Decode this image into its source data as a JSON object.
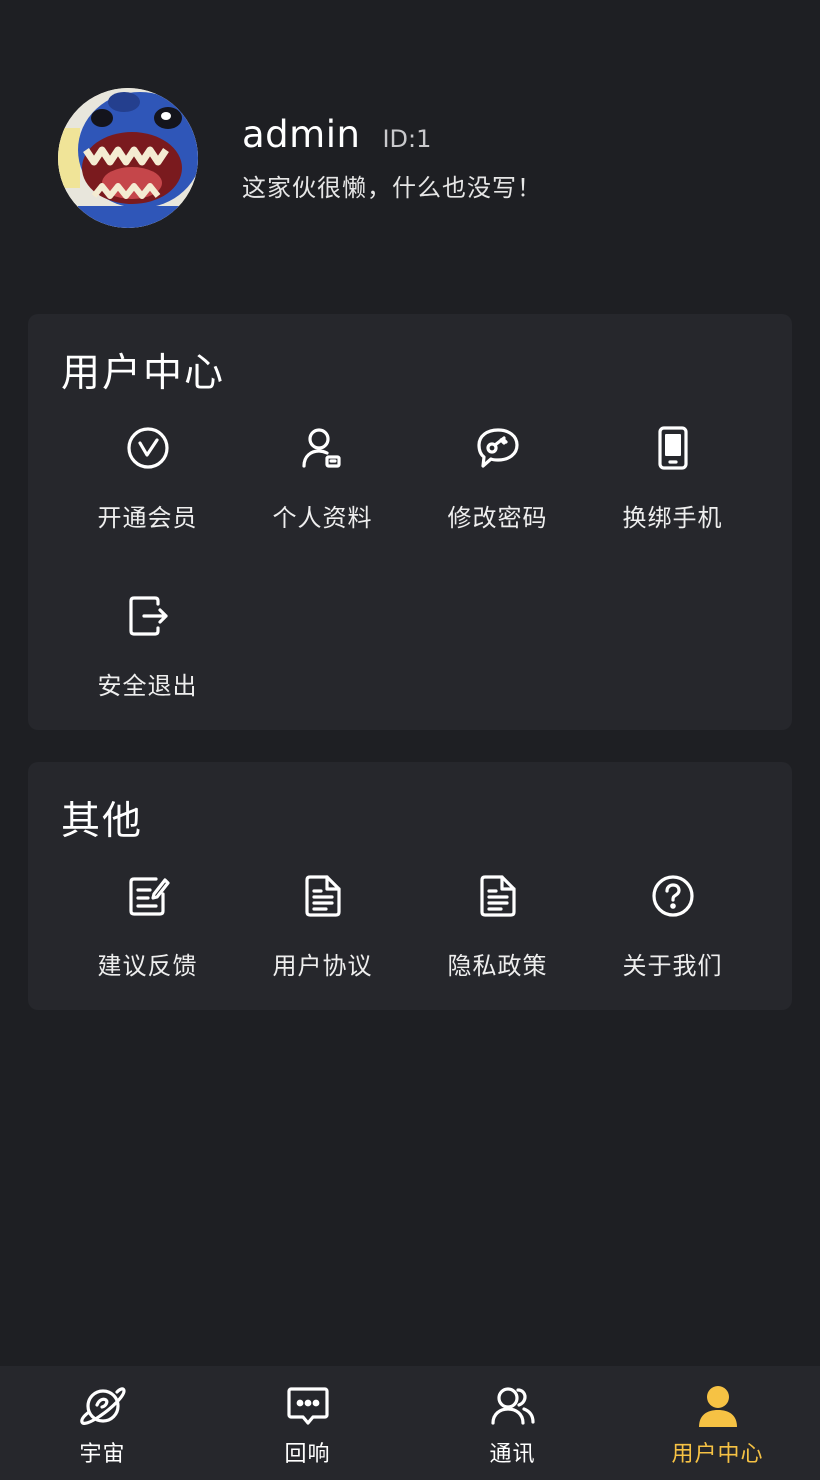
{
  "profile": {
    "username": "admin",
    "id_label": "ID:1",
    "bio": "这家伙很懒，什么也没写！"
  },
  "user_center": {
    "title": "用户中心",
    "items": [
      {
        "label": "开通会员",
        "icon": "vip-icon"
      },
      {
        "label": "个人资料",
        "icon": "user-profile-icon"
      },
      {
        "label": "修改密码",
        "icon": "key-icon"
      },
      {
        "label": "换绑手机",
        "icon": "phone-icon"
      },
      {
        "label": "安全退出",
        "icon": "logout-icon"
      }
    ]
  },
  "other": {
    "title": "其他",
    "items": [
      {
        "label": "建议反馈",
        "icon": "edit-icon"
      },
      {
        "label": "用户协议",
        "icon": "document-icon"
      },
      {
        "label": "隐私政策",
        "icon": "document-icon"
      },
      {
        "label": "关于我们",
        "icon": "help-icon"
      }
    ]
  },
  "tabbar": {
    "tabs": [
      {
        "label": "宇宙",
        "icon": "planet-icon",
        "active": false
      },
      {
        "label": "回响",
        "icon": "chat-icon",
        "active": false
      },
      {
        "label": "通讯",
        "icon": "contacts-icon",
        "active": false
      },
      {
        "label": "用户中心",
        "icon": "user-icon",
        "active": true
      }
    ]
  },
  "colors": {
    "background": "#1e1f23",
    "card": "#26272c",
    "accent": "#f6c244",
    "text": "#ffffff"
  }
}
